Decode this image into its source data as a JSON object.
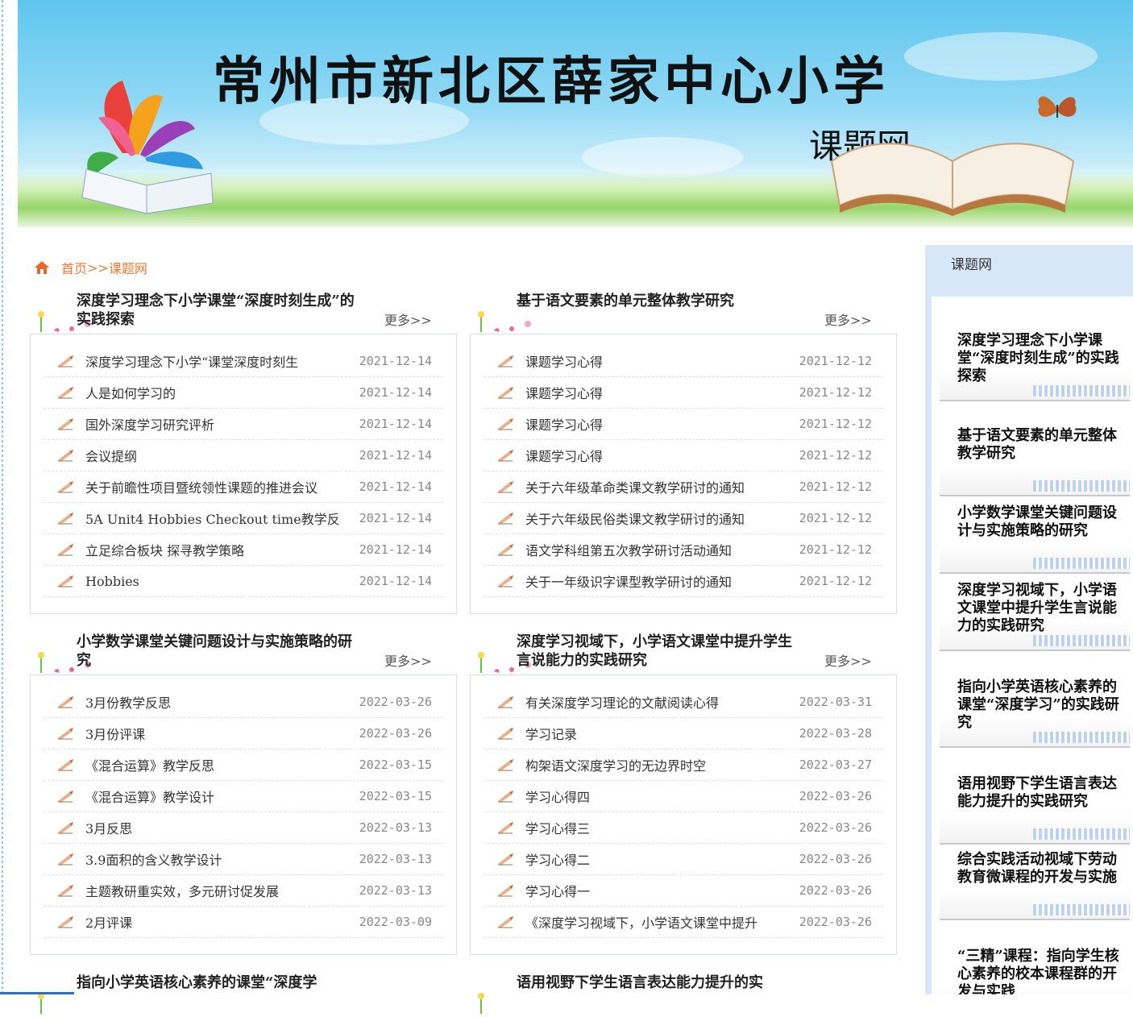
{
  "header": {
    "title": "常州市新北区薛家中心小学",
    "subtitle": "课题网"
  },
  "breadcrumb": {
    "home": "首页",
    "separator": ">>",
    "current": "课题网"
  },
  "panels": [
    {
      "title": "深度学习理念下小学课堂“深度时刻生成”的实践探索",
      "more": "更多>>",
      "items": [
        {
          "title": "深度学习理念下小学“课堂深度时刻生",
          "date": "2021-12-14"
        },
        {
          "title": "人是如何学习的",
          "date": "2021-12-14"
        },
        {
          "title": "国外深度学习研究评析",
          "date": "2021-12-14"
        },
        {
          "title": "会议提纲",
          "date": "2021-12-14"
        },
        {
          "title": "关于前瞻性项目暨统领性课题的推进会议",
          "date": "2021-12-14"
        },
        {
          "title": "5A Unit4 Hobbies Checkout time教学反",
          "date": "2021-12-14"
        },
        {
          "title": "立足综合板块 探寻教学策略",
          "date": "2021-12-14"
        },
        {
          "title": "Hobbies",
          "date": "2021-12-14"
        }
      ]
    },
    {
      "title": "基于语文要素的单元整体教学研究",
      "more": "更多>>",
      "items": [
        {
          "title": "课题学习心得",
          "date": "2021-12-12"
        },
        {
          "title": "课题学习心得",
          "date": "2021-12-12"
        },
        {
          "title": "课题学习心得",
          "date": "2021-12-12"
        },
        {
          "title": "课题学习心得",
          "date": "2021-12-12"
        },
        {
          "title": "关于六年级革命类课文教学研讨的通知",
          "date": "2021-12-12"
        },
        {
          "title": "关于六年级民俗类课文教学研讨的通知",
          "date": "2021-12-12"
        },
        {
          "title": "语文学科组第五次教学研讨活动通知",
          "date": "2021-12-12"
        },
        {
          "title": "关于一年级识字课型教学研讨的通知",
          "date": "2021-12-12"
        }
      ]
    },
    {
      "title": "小学数学课堂关键问题设计与实施策略的研究",
      "more": "更多>>",
      "items": [
        {
          "title": "3月份教学反思",
          "date": "2022-03-26"
        },
        {
          "title": "3月份评课",
          "date": "2022-03-26"
        },
        {
          "title": "《混合运算》教学反思",
          "date": "2022-03-15"
        },
        {
          "title": "《混合运算》教学设计",
          "date": "2022-03-15"
        },
        {
          "title": "3月反思",
          "date": "2022-03-13"
        },
        {
          "title": "3.9面积的含义教学设计",
          "date": "2022-03-13"
        },
        {
          "title": "主题教研重实效，多元研讨促发展",
          "date": "2022-03-13"
        },
        {
          "title": "2月评课",
          "date": "2022-03-09"
        }
      ]
    },
    {
      "title": "深度学习视域下，小学语文课堂中提升学生言说能力的实践研究",
      "more": "更多>>",
      "items": [
        {
          "title": "有关深度学习理论的文献阅读心得",
          "date": "2022-03-31"
        },
        {
          "title": "学习记录",
          "date": "2022-03-28"
        },
        {
          "title": "构架语文深度学习的无边界时空",
          "date": "2022-03-27"
        },
        {
          "title": "学习心得四",
          "date": "2022-03-26"
        },
        {
          "title": "学习心得三",
          "date": "2022-03-26"
        },
        {
          "title": "学习心得二",
          "date": "2022-03-26"
        },
        {
          "title": "学习心得一",
          "date": "2022-03-26"
        },
        {
          "title": "《深度学习视域下，小学语文课堂中提升",
          "date": "2022-03-26"
        }
      ]
    },
    {
      "title": "指向小学英语核心素养的课堂“深度学",
      "more": "",
      "items": []
    },
    {
      "title": "语用视野下学生语言表达能力提升的实",
      "more": "",
      "items": []
    }
  ],
  "sidebar": {
    "title": "课题网",
    "items": [
      "深度学习理念下小学课堂“深度时刻生成”的实践探索",
      "基于语文要素的单元整体教学研究",
      "小学数学课堂关键问题设计与实施策略的研究",
      "深度学习视域下，小学语文课堂中提升学生言说能力的实践研究",
      "指向小学英语核心素养的课堂“深度学习”的实践研究",
      "语用视野下学生语言表达能力提升的实践研究",
      "综合实践活动视域下劳动教育微课程的开发与实施",
      "“三精”课程：指向学生核心素养的校本课程群的开发与实践"
    ]
  }
}
